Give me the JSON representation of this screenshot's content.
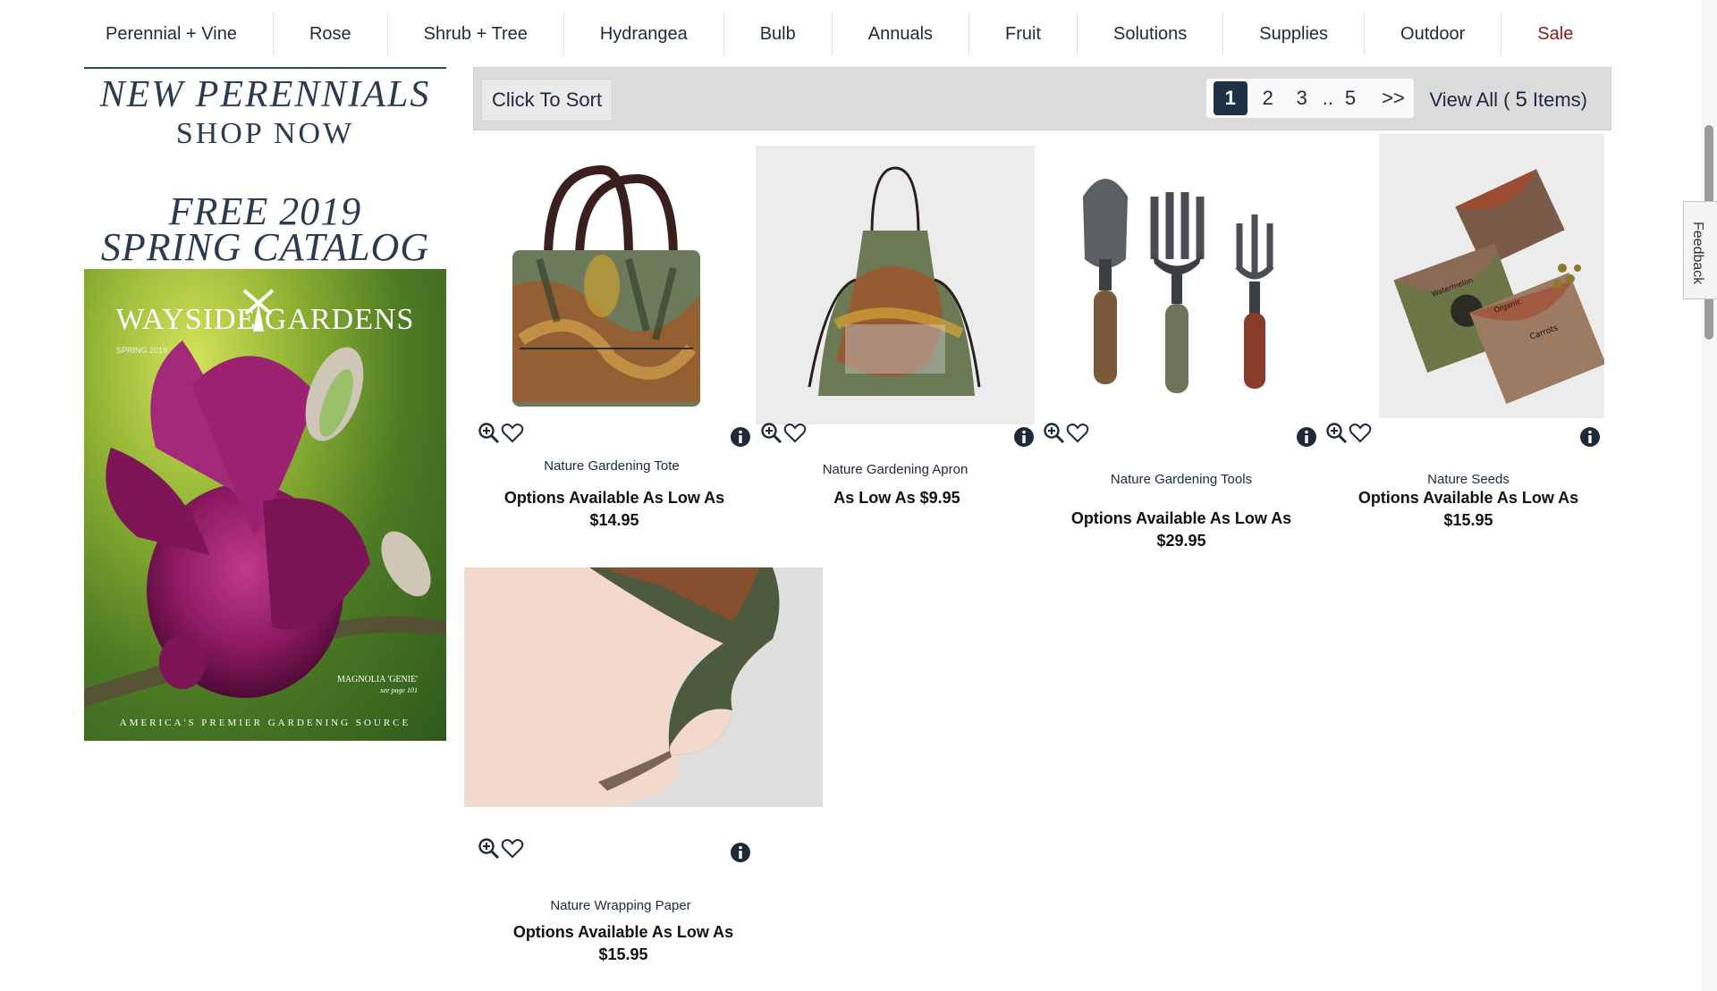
{
  "nav": {
    "items": [
      "Perennial + Vine",
      "Rose",
      "Shrub + Tree",
      "Hydrangea",
      "Bulb",
      "Annuals",
      "Fruit",
      "Solutions",
      "Supplies",
      "Outdoor",
      "Sale"
    ]
  },
  "sidebar": {
    "promo_new": {
      "line1": "NEW PERENNIALS",
      "line2": "SHOP NOW"
    },
    "promo_catalog": {
      "line1": "FREE 2019",
      "line2": "SPRING CATALOG",
      "brand": "WAYSIDE GARDENS",
      "sub": "SPRING 2019",
      "caption": "MAGNOLIA 'GENIE'",
      "caption_note": "see page 101",
      "tagline": "AMERICA'S PREMIER GARDENING SOURCE"
    }
  },
  "toolbar": {
    "sort_label": "Click To Sort",
    "pages": [
      "1",
      "2",
      "3"
    ],
    "dots": "..",
    "last_page": "5",
    "next": ">>",
    "view_all_prefix": "View All (",
    "view_all_count": "5",
    "view_all_suffix": "Items)"
  },
  "products": [
    {
      "name": "Nature Gardening Tote",
      "price_line1": "Options Available As Low As",
      "price_line2": "$14.95"
    },
    {
      "name": "Nature Gardening Apron",
      "price_line1": "As Low As $9.95",
      "price_line2": ""
    },
    {
      "name": "Nature Gardening Tools",
      "price_line1": "Options Available As Low As",
      "price_line2": "$29.95"
    },
    {
      "name": "Nature Seeds",
      "price_line1": "Options Available As Low As",
      "price_line2": "$15.95"
    },
    {
      "name": "Nature Wrapping Paper",
      "price_line1": "Options Available As Low As",
      "price_line2": "$15.95"
    }
  ],
  "seed_labels": [
    "Watermelon",
    "Carrots",
    "Organic"
  ],
  "feedback_label": "Feedback",
  "colors": {
    "nav_text": "#1e2a3a",
    "sale": "#8b1a1a",
    "active_page": "#1e3147",
    "toolbar_bg": "#dcdcdc"
  }
}
